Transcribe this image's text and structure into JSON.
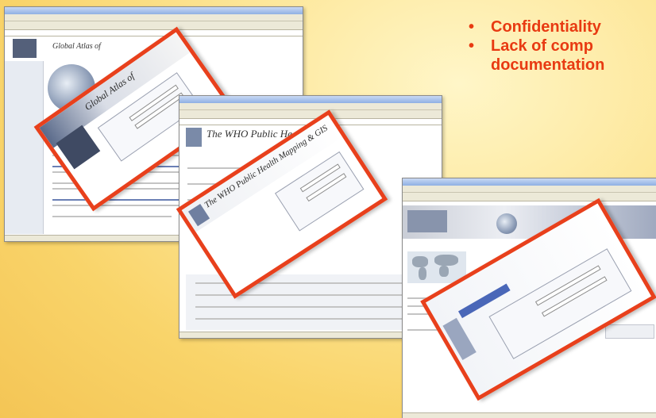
{
  "bullets": [
    {
      "dot": "•",
      "text": "Confidentiality"
    },
    {
      "dot": "•",
      "text": "Lack of comp"
    },
    {
      "dot": "",
      "text": "documentation"
    }
  ],
  "screens": [
    {
      "title": "Global Atlas of"
    },
    {
      "title": "The WHO Public Health"
    },
    {
      "title": ""
    }
  ],
  "overlays": [
    {
      "title": "Global Atlas of"
    },
    {
      "title": "The WHO Public Health Mapping & GIS"
    },
    {
      "title": ""
    }
  ],
  "colors": {
    "accent": "#e83a12",
    "frame": "#e8401c",
    "background": "#f9d46a"
  }
}
